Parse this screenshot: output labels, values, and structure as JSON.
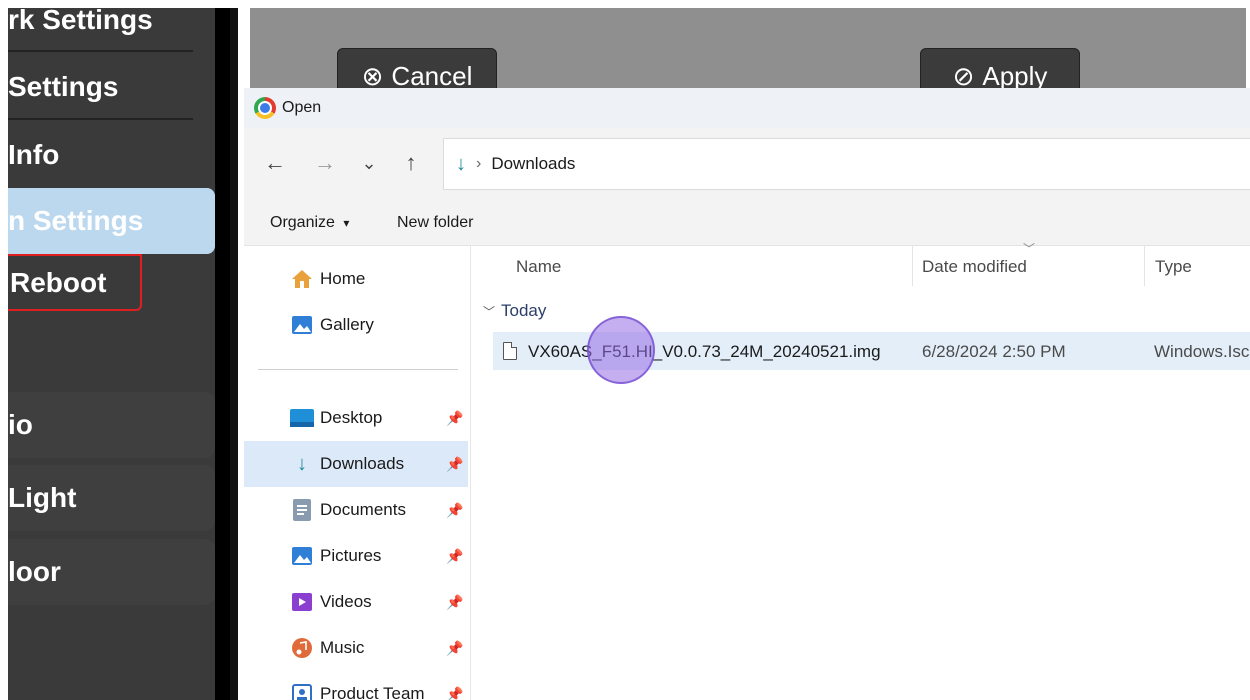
{
  "app": {
    "menu": {
      "items": [
        "rk Settings",
        "Settings",
        "Info",
        "n Settings"
      ],
      "reboot_label": "Reboot",
      "buttons": [
        "io",
        "Light",
        "loor"
      ]
    },
    "cancel_label": "Cancel",
    "apply_label": "Apply"
  },
  "dialog": {
    "title": "Open",
    "nav": {
      "back": "←",
      "forward": "→",
      "recent": "⌄",
      "up": "↑"
    },
    "address": {
      "folder_icon": "↓",
      "separator": "›",
      "location": "Downloads"
    },
    "command_bar": {
      "organize_label": "Organize",
      "organize_caret": "▾",
      "new_folder_label": "New folder"
    },
    "nav_pane": {
      "top_items": [
        {
          "label": "Home",
          "icon": "home-icon"
        },
        {
          "label": "Gallery",
          "icon": "gallery-icon"
        }
      ],
      "quick_access": [
        {
          "label": "Desktop",
          "icon": "desktop-icon",
          "selected": false
        },
        {
          "label": "Downloads",
          "icon": "downloads-icon",
          "selected": true
        },
        {
          "label": "Documents",
          "icon": "documents-icon",
          "selected": false
        },
        {
          "label": "Pictures",
          "icon": "pictures-icon",
          "selected": false
        },
        {
          "label": "Videos",
          "icon": "videos-icon",
          "selected": false
        },
        {
          "label": "Music",
          "icon": "music-icon",
          "selected": false
        },
        {
          "label": "Product Team",
          "icon": "product-team-icon",
          "selected": false
        }
      ]
    },
    "columns": {
      "name": "Name",
      "date_modified": "Date modified",
      "type": "Type"
    },
    "group_label": "Today",
    "files": [
      {
        "name": "VX60AS_F51.HI_V0.0.73_24M_20240521.img",
        "date_modified": "6/28/2024 2:50 PM",
        "type": "Windows.Isc"
      }
    ]
  },
  "colors": {
    "selected_row": "#e3eef9",
    "selected_nav": "#dbe9f8",
    "accent_teal": "#1e8a9b",
    "reboot_border": "#e02020",
    "click_marker": "#9670e6"
  }
}
